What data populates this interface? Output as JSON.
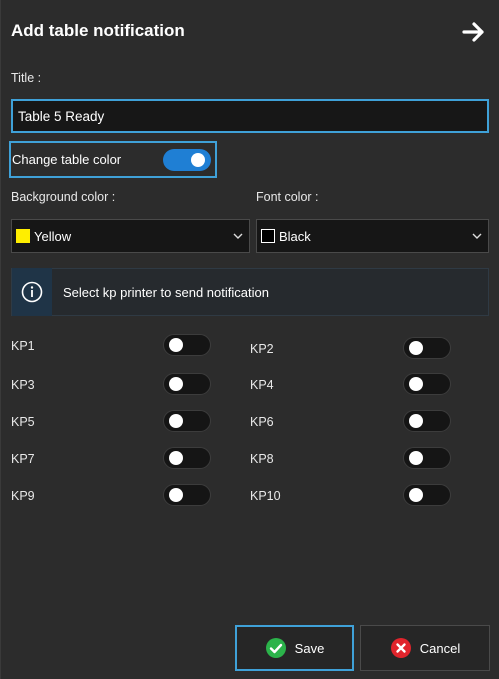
{
  "header": {
    "title": "Add table notification"
  },
  "form": {
    "title_label": "Title :",
    "title_value": "Table 5 Ready",
    "change_color_label": "Change table color",
    "change_color_on": true,
    "bg_label": "Background color :",
    "bg_value": "Yellow",
    "bg_swatch": "#ffee00",
    "font_label": "Font color :",
    "font_value": "Black",
    "font_swatch": "#000000"
  },
  "info": {
    "text": "Select kp printer to send notification"
  },
  "printers": [
    {
      "label": "KP1",
      "on": false
    },
    {
      "label": "KP2",
      "on": false
    },
    {
      "label": "KP3",
      "on": false
    },
    {
      "label": "KP4",
      "on": false
    },
    {
      "label": "KP5",
      "on": false
    },
    {
      "label": "KP6",
      "on": false
    },
    {
      "label": "KP7",
      "on": false
    },
    {
      "label": "KP8",
      "on": false
    },
    {
      "label": "KP9",
      "on": false
    },
    {
      "label": "KP10",
      "on": false
    }
  ],
  "footer": {
    "save_label": "Save",
    "cancel_label": "Cancel"
  },
  "colors": {
    "accent": "#3fa1d8",
    "toggle_on": "#1f7fd4",
    "save_green": "#2bb34a",
    "cancel_red": "#e0242c"
  }
}
